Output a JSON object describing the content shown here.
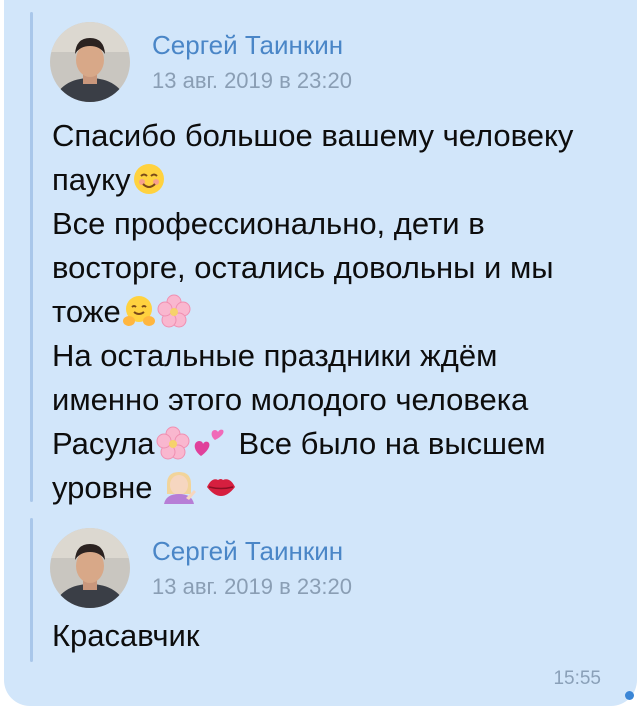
{
  "colors": {
    "bubble": "#d2e6fa",
    "author": "#4a86c7",
    "date": "#8a9eb4",
    "forward_bar": "#a9c7ea",
    "unread_dot": "#3b86d6"
  },
  "messages": [
    {
      "author": "Сергей Таинкин",
      "date": "13 авг. 2019 в 23:20",
      "avatar_icon": "user-photo",
      "lines": {
        "l1": "Спасибо большое вашему человеку",
        "l2": "пауку",
        "l3": "Все профессионально, дети в",
        "l4": "восторге, остались довольны и мы",
        "l5": "тоже",
        "l6": "На остальные праздники ждём",
        "l7": "именно этого молодого человека",
        "l8a": "Расула",
        "l8b": "Все было на высшем",
        "l9": "уровне"
      },
      "emojis": [
        "smiling-blush",
        "hugging-face",
        "cherry-blossom",
        "cherry-blossom",
        "two-hearts",
        "woman-tipping-hand",
        "kiss-mark"
      ]
    },
    {
      "author": "Сергей Таинкин",
      "date": "13 авг. 2019 в 23:20",
      "avatar_icon": "user-photo",
      "text": "Красавчик"
    }
  ],
  "time": "15:55"
}
